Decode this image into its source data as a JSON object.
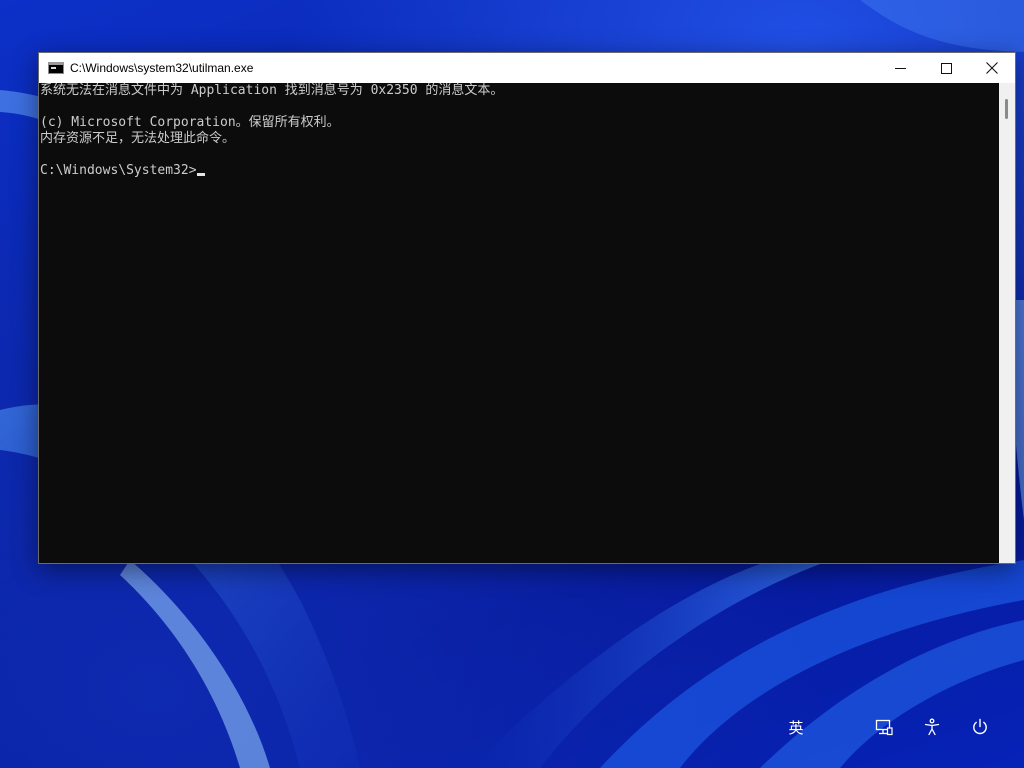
{
  "window": {
    "title": "C:\\Windows\\system32\\utilman.exe",
    "controls": {
      "minimize_icon": "minimize-icon",
      "maximize_icon": "maximize-icon",
      "close_icon": "close-icon"
    }
  },
  "console": {
    "lines": [
      "系统无法在消息文件中为 Application 找到消息号为 0x2350 的消息文本。",
      "",
      "(c) Microsoft Corporation。保留所有权利。",
      "内存资源不足，无法处理此命令。",
      "",
      "C:\\Windows\\System32>"
    ],
    "text_color": "#cccccc",
    "background": "#0c0c0c"
  },
  "tray": {
    "ime_label": "英",
    "network_icon": "network-icon",
    "accessibility_icon": "accessibility-icon",
    "power_icon": "power-icon"
  }
}
